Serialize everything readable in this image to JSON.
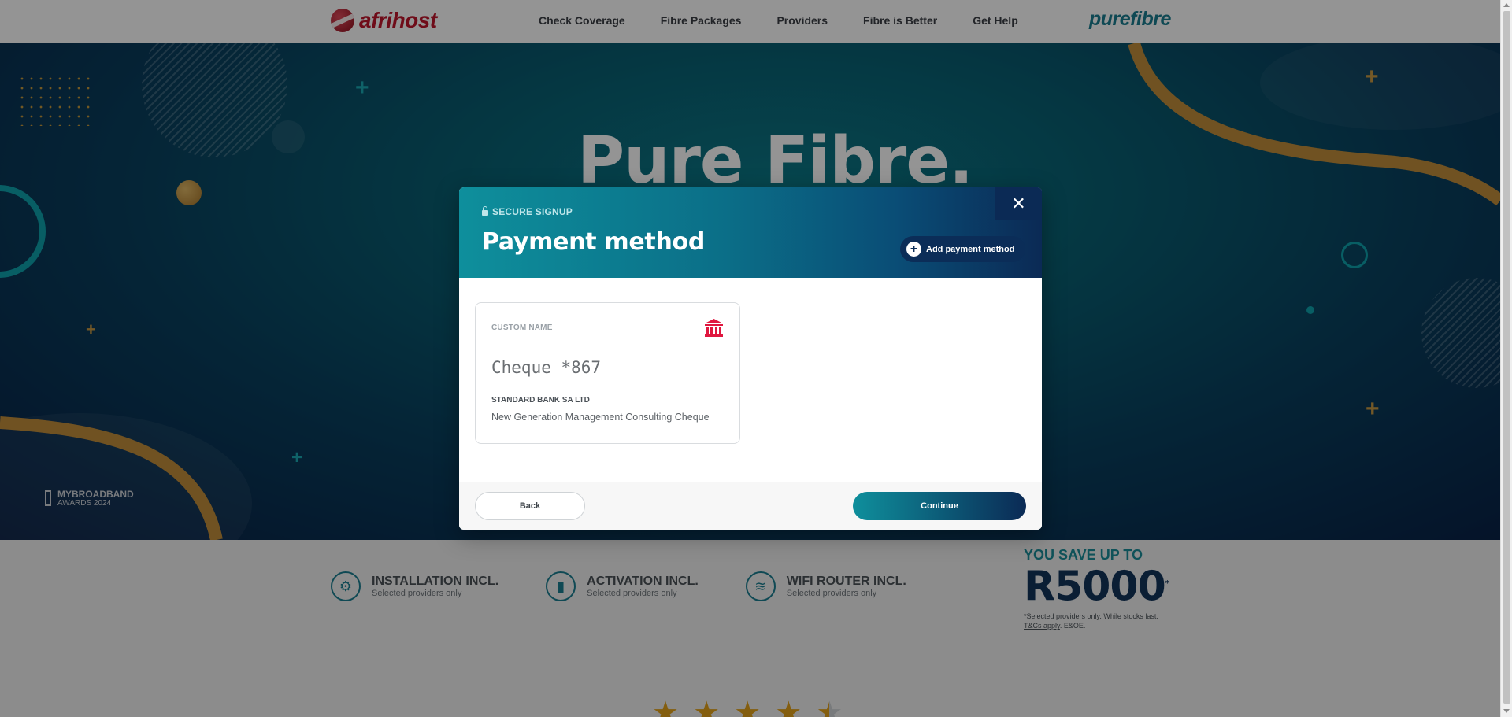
{
  "header": {
    "brand": "afrihost",
    "nav": [
      "Check Coverage",
      "Fibre Packages",
      "Providers",
      "Fibre is Better",
      "Get Help"
    ],
    "partner_brand": "purefibre"
  },
  "hero": {
    "title": "Pure Fibre.",
    "award_line1": "MYBROADBAND",
    "award_line2": "AWARDS 2024"
  },
  "features": [
    {
      "title": "INSTALLATION INCL.",
      "sub": "Selected providers only",
      "icon": "gear-icon"
    },
    {
      "title": "ACTIVATION INCL.",
      "sub": "Selected providers only",
      "icon": "router-icon"
    },
    {
      "title": "WIFI ROUTER INCL.",
      "sub": "Selected providers only",
      "icon": "wifi-icon"
    }
  ],
  "savings": {
    "headline": "YOU SAVE UP TO",
    "amount": "R5000",
    "asterisk": "*",
    "disclaimer": "*Selected providers only. While stocks last.",
    "tcs": "T&Cs apply",
    "eoe": ". E&OE."
  },
  "rating": {
    "value": 4.5,
    "max": 5
  },
  "modal": {
    "eyebrow": "SECURE SIGNUP",
    "title": "Payment method",
    "add_label": "Add payment method",
    "card": {
      "custom_name_label": "CUSTOM NAME",
      "account": "Cheque *867",
      "bank": "STANDARD BANK SA LTD",
      "holder": "New Generation Management Consulting Cheque",
      "icon": "bank-icon"
    },
    "back_label": "Back",
    "continue_label": "Continue"
  },
  "colors": {
    "brand_red": "#c0162c",
    "teal": "#0e8f9c",
    "navy": "#0b2a55",
    "gold": "#c99a44",
    "bank_icon": "#e0173f"
  }
}
